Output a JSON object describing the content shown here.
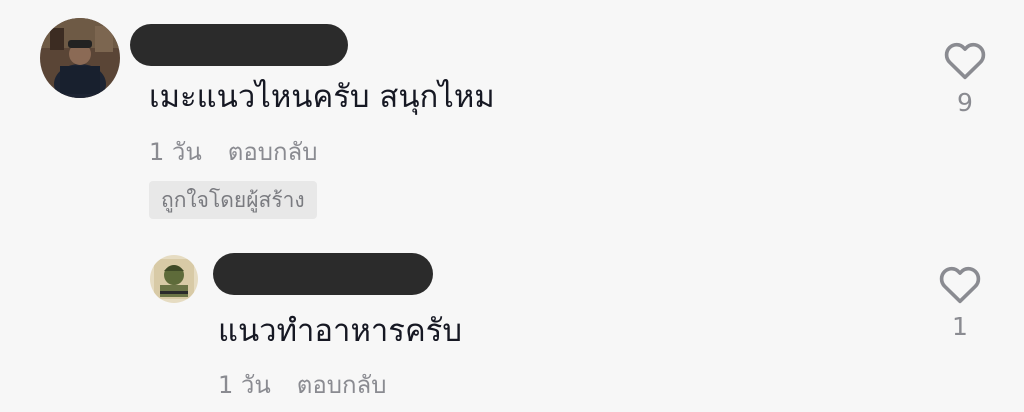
{
  "comments": [
    {
      "text": "เมะแนวไหนครับ สนุกไหม",
      "time": "1 วัน",
      "reply_label": "ตอบกลับ",
      "badge": "ถูกใจโดยผู้สร้าง",
      "likes": "9"
    },
    {
      "text": "แนวทำอาหารครับ",
      "time": "1 วัน",
      "reply_label": "ตอบกลับ",
      "likes": "1"
    }
  ],
  "icons": {
    "like": "heart-outline-icon"
  },
  "colors": {
    "background": "#f7f7f7",
    "text": "#161823",
    "muted": "#8a8b91",
    "redaction": "#2b2b2b"
  }
}
